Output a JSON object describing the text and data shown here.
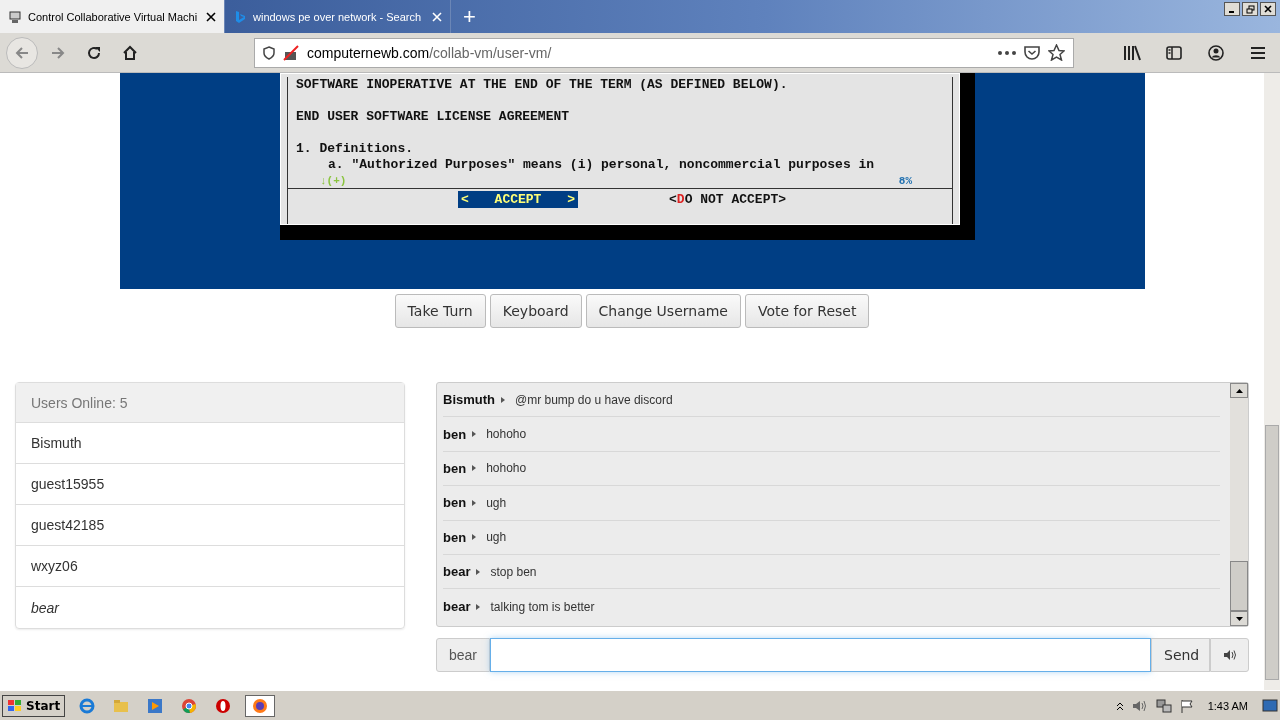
{
  "browser": {
    "tabs": [
      {
        "title": "Control Collaborative Virtual Machi",
        "selected": true
      },
      {
        "title": "windows pe over network - Search",
        "selected": false
      }
    ],
    "new_tab": "+",
    "url_domain": "computernewb.com",
    "url_path": "/collab-vm/user-vm/"
  },
  "vm_screen": {
    "paragraphs": [
      {
        "lines": [
          {
            "text": "SOFTWARE INOPERATIVE AT THE END OF THE TERM (AS DEFINED BELOW).",
            "indented": false
          }
        ]
      },
      {
        "lines": [
          {
            "text": "END USER SOFTWARE LICENSE AGREEMENT",
            "indented": false
          }
        ]
      },
      {
        "lines": [
          {
            "text": "1. Definitions.",
            "indented": false
          },
          {
            "text": "a. \"Authorized Purposes\" means (i) personal, noncommercial purposes in",
            "indented": true
          }
        ]
      }
    ],
    "scroll_hint": "↓(+)",
    "percent": "8%",
    "options": [
      {
        "open": "<",
        "hotkey": "A",
        "rest": "CCEPT",
        "close": ">",
        "selected": true
      },
      {
        "open": "<",
        "hotkey": "D",
        "rest": "O NOT ACCEPT",
        "close": ">",
        "selected": false
      }
    ]
  },
  "controls": [
    "Take Turn",
    "Keyboard",
    "Change Username",
    "Vote for Reset"
  ],
  "users": {
    "header": "Users Online: 5",
    "items": [
      {
        "name": "Bismuth",
        "self": false
      },
      {
        "name": "guest15955",
        "self": false
      },
      {
        "name": "guest42185",
        "self": false
      },
      {
        "name": "wxyz06",
        "self": false
      },
      {
        "name": "bear",
        "self": true
      }
    ]
  },
  "chat": {
    "messages": [
      {
        "user": "Bismuth",
        "text": "@mr bump do u have discord"
      },
      {
        "user": "ben",
        "text": "hohoho"
      },
      {
        "user": "ben",
        "text": "hohoho"
      },
      {
        "user": "ben",
        "text": "ugh"
      },
      {
        "user": "ben",
        "text": "ugh"
      },
      {
        "user": "bear",
        "text": "stop ben"
      },
      {
        "user": "bear",
        "text": "talking tom is better"
      }
    ],
    "username": "bear",
    "send": "Send"
  },
  "taskbar": {
    "start": "Start",
    "clock": "1:43 AM"
  }
}
